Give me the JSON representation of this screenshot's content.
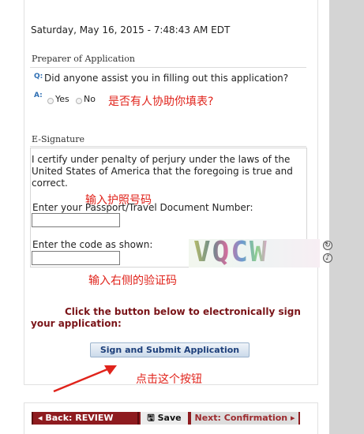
{
  "timestamp": "Saturday, May 16, 2015 - 7:48:43 AM EDT",
  "preparer": {
    "heading": "Preparer of Application",
    "q_label": "Q:",
    "question": "Did anyone assist you in filling out this application?",
    "a_label": "A:",
    "option_yes": "Yes",
    "option_no": "No",
    "annotation": "是否有人协助你填表?"
  },
  "esignature": {
    "heading": "E-Signature",
    "certify": "I certify under penalty of perjury under the laws of the United States of America that the foregoing is true and correct.",
    "passport_annotation": "输入护照号码",
    "passport_label": "Enter your Passport/Travel Document Number:",
    "passport_value": "",
    "code_label": "Enter the code as shown:",
    "code_value": "",
    "captcha_text": "VQCW",
    "captcha_refresh_icon": "refresh-icon",
    "captcha_audio_icon": "audio-icon",
    "captcha_annotation": "输入右侧的验证码"
  },
  "submit": {
    "instruction_line1": "Click the button below to electronically sign",
    "instruction_line2": "your application:",
    "button_label": "Sign and Submit Application",
    "annotation": "点击这个按钮"
  },
  "nav": {
    "back_label": "Back: REVIEW",
    "save_label": "Save",
    "next_label": "Next: Confirmation",
    "accent_color": "#8e1b1f"
  }
}
